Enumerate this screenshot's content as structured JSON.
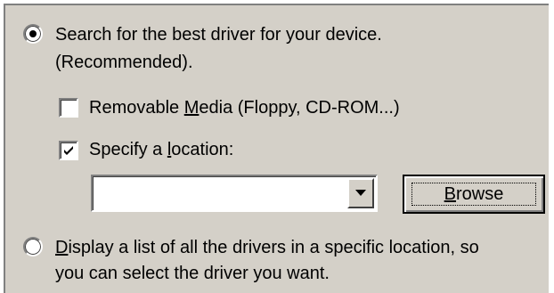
{
  "dialog": {
    "search_option": {
      "line1": "Search for the best driver for your device.",
      "line2": "(Recommended).",
      "selected": true
    },
    "removable_media": {
      "label_before": "Removable ",
      "label_accel": "M",
      "label_after": "edia (Floppy, CD-ROM...)",
      "checked": false
    },
    "specify_location": {
      "label_before": "Specify a ",
      "label_accel": "l",
      "label_after": "ocation:",
      "checked": true
    },
    "location_combo": {
      "value": ""
    },
    "browse_button": {
      "label_accel": "B",
      "label_after": "rowse"
    },
    "display_option": {
      "line1_accel": "D",
      "line1_after": "isplay a list of all the drivers in a specific location, so",
      "line2": "you can select the driver you want.",
      "selected": false
    }
  }
}
